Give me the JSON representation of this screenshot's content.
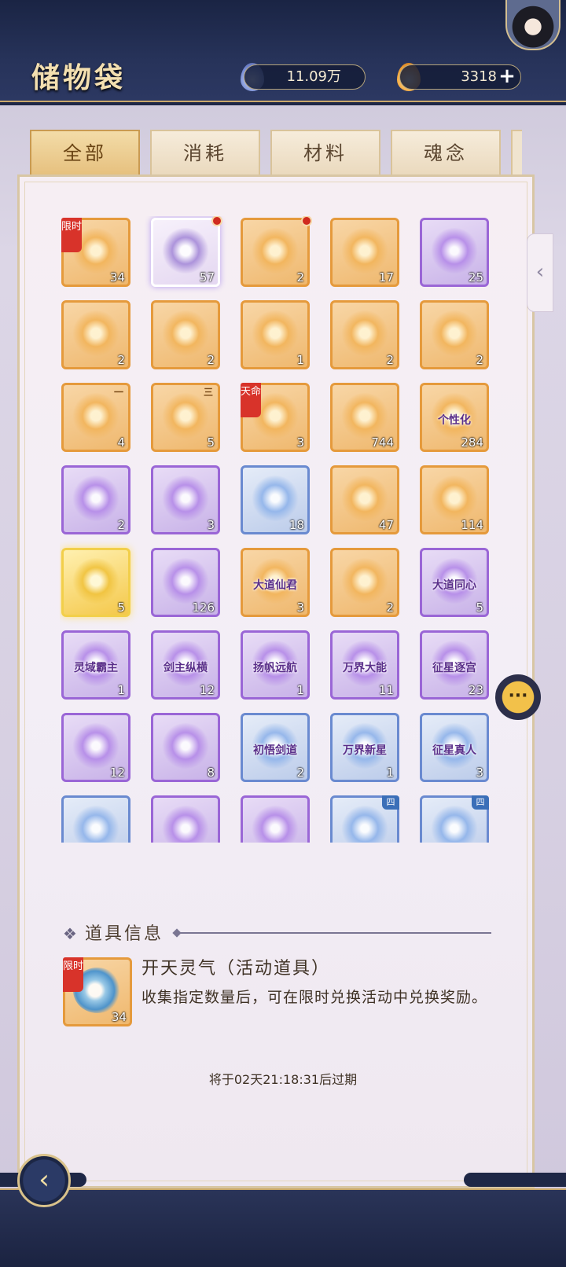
{
  "header": {
    "title": "储物袋",
    "spirit_currency": "11.09万",
    "gold_currency": "3318",
    "plus_label": "+"
  },
  "tabs": [
    {
      "label": "全部",
      "active": true,
      "badge": true
    },
    {
      "label": "消耗",
      "active": false,
      "badge": true
    },
    {
      "label": "材料",
      "active": false,
      "badge": false
    },
    {
      "label": "魂念",
      "active": false,
      "badge": false
    }
  ],
  "items": [
    {
      "count": "34",
      "rarity": "orange",
      "tag": "限时",
      "icon": "swirl-orb-icon"
    },
    {
      "count": "57",
      "rarity": "white",
      "dot": true,
      "icon": "immortal-figure-icon"
    },
    {
      "count": "2",
      "rarity": "orange",
      "dot": true,
      "icon": "treasure-chest-icon"
    },
    {
      "count": "17",
      "rarity": "orange",
      "icon": "fire-spirit-icon"
    },
    {
      "count": "25",
      "rarity": "purple",
      "icon": "purple-flame-icon"
    },
    {
      "count": "2",
      "rarity": "orange",
      "icon": "water-flask-icon"
    },
    {
      "count": "2",
      "rarity": "orange",
      "icon": "hero-box-icon"
    },
    {
      "count": "1",
      "rarity": "orange",
      "icon": "silver-chest-icon"
    },
    {
      "count": "2",
      "rarity": "orange",
      "icon": "red-gem-pack-icon"
    },
    {
      "count": "2",
      "rarity": "orange",
      "icon": "scroll-bundle-icon"
    },
    {
      "count": "4",
      "rarity": "orange",
      "roman": "一",
      "icon": "seal-box-icon"
    },
    {
      "count": "5",
      "rarity": "orange",
      "roman": "三",
      "icon": "seal-box-icon"
    },
    {
      "count": "3",
      "rarity": "orange",
      "tag": "天命",
      "icon": "destiny-pack-icon"
    },
    {
      "count": "744",
      "rarity": "orange",
      "icon": "mirror-icon"
    },
    {
      "count": "284",
      "rarity": "orange",
      "label": "个性化",
      "icon": "name-scroll-icon"
    },
    {
      "count": "2",
      "rarity": "purple",
      "icon": "purple-pack-icon"
    },
    {
      "count": "3",
      "rarity": "purple",
      "icon": "purple-book-icon"
    },
    {
      "count": "18",
      "rarity": "blue",
      "icon": "blue-book-icon"
    },
    {
      "count": "47",
      "rarity": "orange",
      "icon": "fire-sword-emblem-icon"
    },
    {
      "count": "114",
      "rarity": "orange",
      "icon": "ice-sword-emblem-icon"
    },
    {
      "count": "5",
      "rarity": "gold",
      "icon": "golden-chest-icon"
    },
    {
      "count": "126",
      "rarity": "purple",
      "icon": "lotus-meditation-icon"
    },
    {
      "count": "3",
      "rarity": "orange",
      "label": "大道仙君",
      "icon": "title-badge-icon"
    },
    {
      "count": "2",
      "rarity": "orange",
      "icon": "fire-ring-icon"
    },
    {
      "count": "5",
      "rarity": "purple",
      "label": "大道同心",
      "icon": "title-badge-icon"
    },
    {
      "count": "1",
      "rarity": "purple",
      "label": "灵域霸主",
      "icon": "title-badge-icon"
    },
    {
      "count": "12",
      "rarity": "purple",
      "label": "剑主纵横",
      "icon": "title-badge-icon"
    },
    {
      "count": "1",
      "rarity": "purple",
      "label": "扬帆远航",
      "icon": "title-badge-icon"
    },
    {
      "count": "11",
      "rarity": "purple",
      "label": "万界大能",
      "icon": "title-badge-icon"
    },
    {
      "count": "23",
      "rarity": "purple",
      "label": "征星逐宫",
      "icon": "title-badge-icon"
    },
    {
      "count": "12",
      "rarity": "purple",
      "icon": "sword-ring-icon"
    },
    {
      "count": "8",
      "rarity": "purple",
      "icon": "moon-ring-icon"
    },
    {
      "count": "2",
      "rarity": "blue",
      "label": "初悟剑道",
      "icon": "title-badge-icon"
    },
    {
      "count": "1",
      "rarity": "blue",
      "label": "万界新星",
      "icon": "title-badge-icon"
    },
    {
      "count": "3",
      "rarity": "blue",
      "label": "征星真人",
      "icon": "title-badge-icon"
    },
    {
      "count": "",
      "rarity": "blue",
      "icon": "blue-scroll-icon"
    },
    {
      "count": "",
      "rarity": "purple",
      "icon": "purple-ring-icon"
    },
    {
      "count": "",
      "rarity": "purple",
      "icon": "orange-ring-icon"
    },
    {
      "count": "",
      "rarity": "blue",
      "corner": "四",
      "icon": "vase-icon"
    },
    {
      "count": "",
      "rarity": "blue",
      "corner": "四",
      "icon": "vase-icon"
    }
  ],
  "info": {
    "heading": "道具信息",
    "selected_count": "34",
    "selected_tag": "限时",
    "name": "开天灵气（活动道具）",
    "description": "收集指定数量后，可在限时兑换活动中兑换奖励。",
    "expire": "将于02天21:18:31后过期"
  },
  "controls": {
    "side_handle": "‹",
    "chat": "···",
    "back": "‹"
  }
}
